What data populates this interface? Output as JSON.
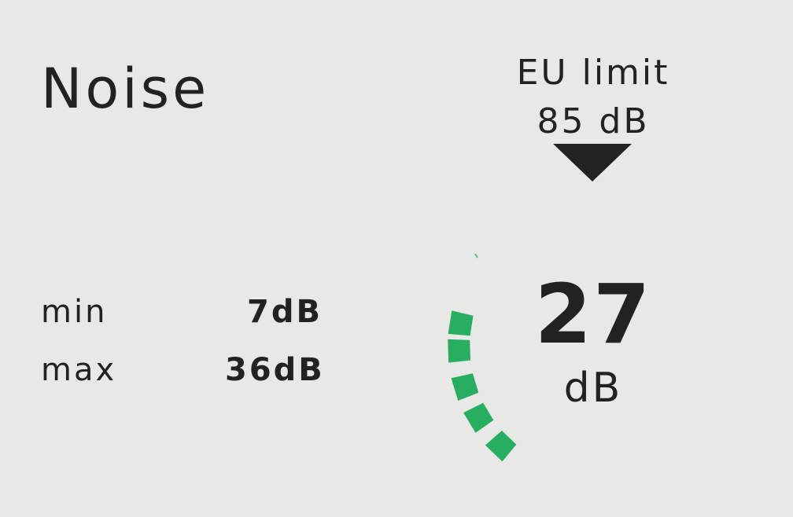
{
  "title": "Noise",
  "limit": {
    "label": "EU limit",
    "value": "85 dB"
  },
  "stats": [
    {
      "label": "min",
      "value": "7dB"
    },
    {
      "label": "max",
      "value": "36dB"
    }
  ],
  "reading": {
    "value": "27",
    "unit": "dB"
  },
  "gauge": {
    "active_color": "#27ae60",
    "active_segments": 5
  }
}
